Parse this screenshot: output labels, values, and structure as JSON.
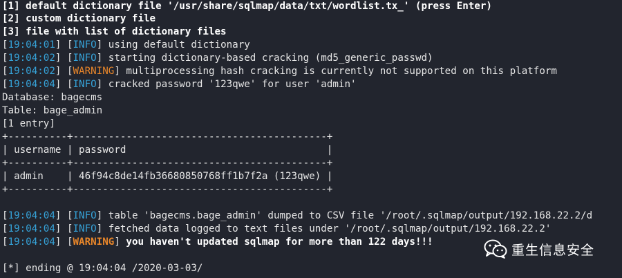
{
  "menu": {
    "opt1": "[1] default dictionary file '/usr/share/sqlmap/data/txt/wordlist.tx_' (press Enter)",
    "opt2": "[2] custom dictionary file",
    "opt3": "[3] file with list of dictionary files"
  },
  "log1": [
    {
      "ts": "19:04:01",
      "level": "INFO",
      "msg": " using default dictionary"
    },
    {
      "ts": "19:04:02",
      "level": "INFO",
      "msg": " starting dictionary-based cracking (md5_generic_passwd)"
    },
    {
      "ts": "19:04:02",
      "level": "WARNING",
      "msg": " multiprocessing hash cracking is currently not supported on this platform"
    },
    {
      "ts": "19:04:04",
      "level": "INFO",
      "msg": " cracked password '123qwe' for user 'admin'"
    }
  ],
  "db": {
    "database": "Database: bagecms",
    "table": "Table: bage_admin",
    "entries": "[1 entry]"
  },
  "table": {
    "border": "+----------+-------------------------------------------+",
    "header": "| username | password                                  |",
    "row": "| admin    | 46f94c8de14fb36680850768ff1b7f2a (123qwe) |"
  },
  "log2": [
    {
      "ts": "19:04:04",
      "level": "INFO",
      "msg": " table 'bagecms.bage_admin' dumped to CSV file '/root/.sqlmap/output/192.168.22.2/d"
    },
    {
      "ts": "19:04:04",
      "level": "INFO",
      "msg": " fetched data logged to text files under '/root/.sqlmap/output/192.168.22.2'"
    },
    {
      "ts": "19:04:04",
      "level": "WARNING",
      "msg": " you haven't updated sqlmap for more than 122 days!!!"
    }
  ],
  "ending": "[*] ending @ 19:04:04 /2020-03-03/",
  "watermark": {
    "text": "重生信息安全",
    "icon": "wechat-icon"
  },
  "colors": {
    "background": "#22252e",
    "timestamp": "#36a3d9",
    "warning": "#e8862a",
    "text": "#e6e6e6"
  }
}
